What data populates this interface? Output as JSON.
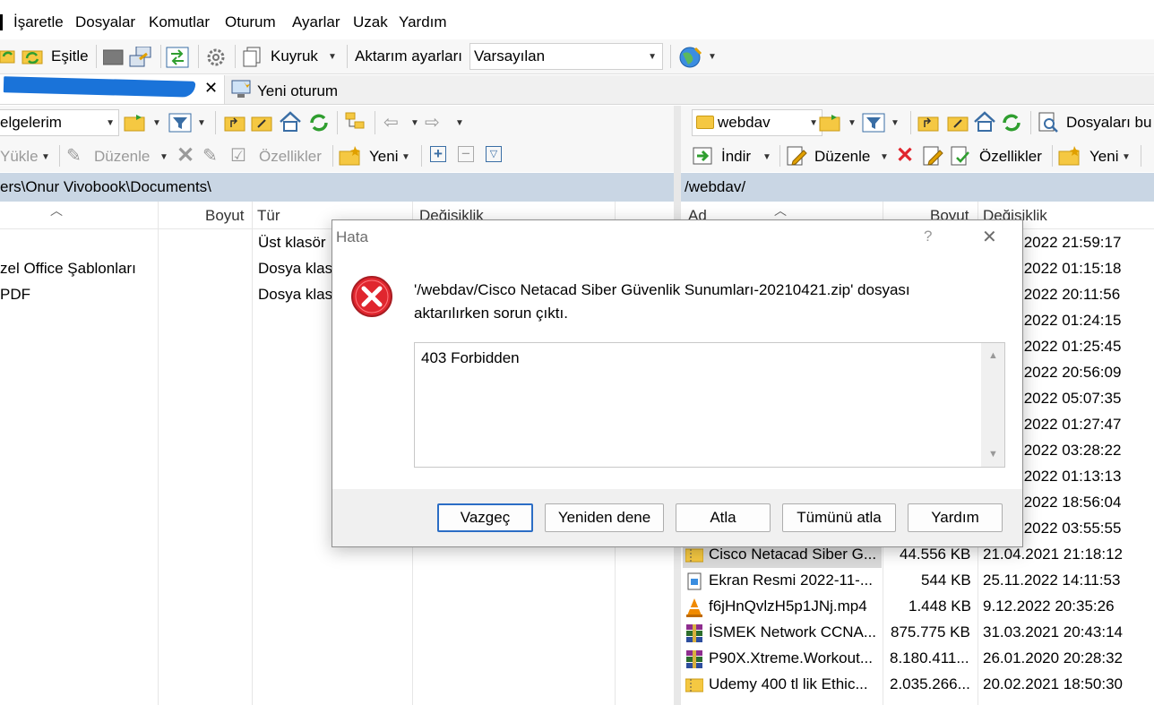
{
  "menu": [
    "İşaretle",
    "Dosyalar",
    "Komutlar",
    "Oturum",
    "Ayarlar",
    "Uzak",
    "Yardım"
  ],
  "toolbar": {
    "sync_label": "Eşitle",
    "queue_label": "Kuyruk",
    "transfer_label": "Aktarım ayarları",
    "transfer_value": "Varsayılan"
  },
  "tabs": {
    "new_session": "Yeni oturum"
  },
  "left": {
    "location": "elgelerim",
    "actions": {
      "upload": "Yükle",
      "edit": "Düzenle",
      "properties": "Özellikler",
      "new": "Yeni"
    },
    "path": "ers\\Onur Vivobook\\Documents\\",
    "columns": {
      "size": "Boyut",
      "type": "Tür",
      "changed": "Değişiklik"
    },
    "rows": [
      {
        "name": "",
        "type": "Üst klasör"
      },
      {
        "name": "zel Office Şablonları",
        "type": "Dosya klas"
      },
      {
        "name": "PDF",
        "type": "Dosya klas"
      }
    ]
  },
  "right": {
    "location": "webdav",
    "find_label": "Dosyaları bu",
    "actions": {
      "download": "İndir",
      "edit": "Düzenle",
      "properties": "Özellikler",
      "new": "Yeni"
    },
    "path": "/webdav/",
    "columns": {
      "name": "Ad",
      "size": "Boyut",
      "changed": "Değişiklik"
    },
    "partial_dates": [
      ".2022 21:59:17",
      ".2022 01:15:18",
      ".2022 20:11:56",
      ".2022 01:24:15",
      ".2022 01:25:45",
      ".2022 20:56:09",
      ".2022 05:07:35",
      ".2022 01:27:47",
      ".2022 03:28:22",
      ".2022 01:13:13",
      ".2022 18:56:04",
      ".2022 03:55:55"
    ],
    "rows": [
      {
        "name": "Cisco Netacad Siber G...",
        "size": "44.556 KB",
        "changed": "21.04.2021 21:18:12",
        "icon": "zip-icon"
      },
      {
        "name": "Ekran Resmi 2022-11-...",
        "size": "544 KB",
        "changed": "25.11.2022 14:11:53",
        "icon": "image-icon"
      },
      {
        "name": "f6jHnQvlzH5p1JNj.mp4",
        "size": "1.448 KB",
        "changed": "9.12.2022 20:35:26",
        "icon": "vlc-icon"
      },
      {
        "name": "İSMEK Network CCNA...",
        "size": "875.775 KB",
        "changed": "31.03.2021 20:43:14",
        "icon": "rar-icon"
      },
      {
        "name": "P90X.Xtreme.Workout...",
        "size": "8.180.411...",
        "changed": "26.01.2020 20:28:32",
        "icon": "rar-icon"
      },
      {
        "name": "Udemy 400 tl lik Ethic...",
        "size": "2.035.266...",
        "changed": "20.02.2021 18:50:30",
        "icon": "zip-icon"
      }
    ]
  },
  "dialog": {
    "title": "Hata",
    "help_glyph": "?",
    "close_glyph": "✕",
    "message_line1": "'/webdav/Cisco Netacad Siber Güvenlik Sunumları-20210421.zip' dosyası",
    "message_line2": "aktarılırken sorun çıktı.",
    "detail": "403 Forbidden",
    "buttons": {
      "cancel": "Vazgeç",
      "retry": "Yeniden dene",
      "skip": "Atla",
      "skip_all": "Tümünü atla",
      "help": "Yardım"
    }
  },
  "colors": {
    "path_bar": "#c9d6e4",
    "error": "#e0262e",
    "accent": "#2b6dc5",
    "redaction": "#1a73d9"
  }
}
